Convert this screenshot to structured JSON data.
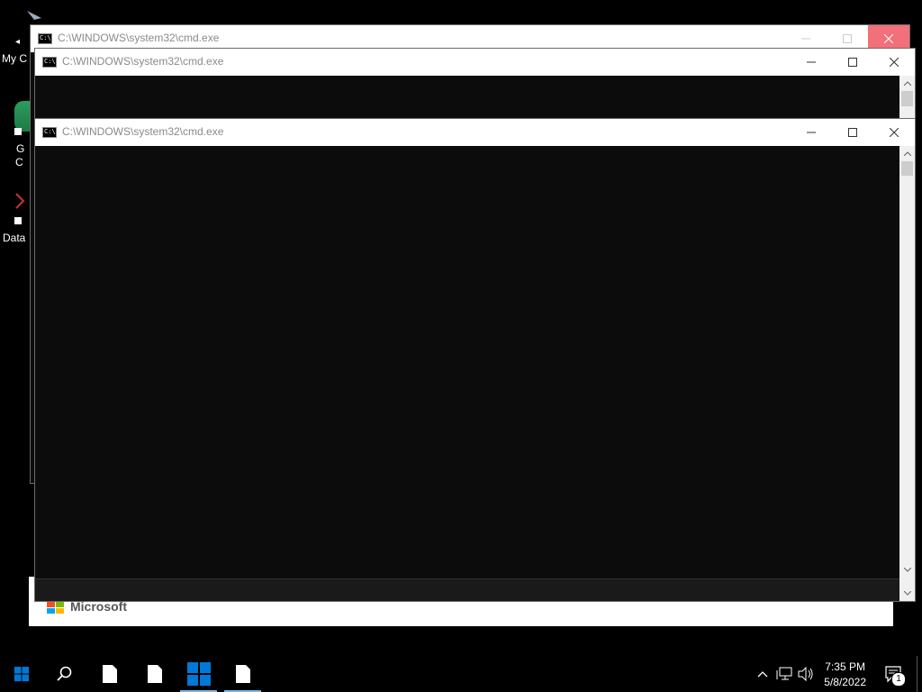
{
  "desktop": {
    "icons": [
      {
        "label": "My C",
        "icon": "computer-icon"
      },
      {
        "label": "G",
        "sub": "C",
        "icon": "chrome-icon"
      },
      {
        "label": "Data",
        "icon": "database-icon"
      }
    ],
    "partial_brand_text": "Microsoft"
  },
  "windows": [
    {
      "title": "C:\\WINDOWS\\system32\\cmd.exe",
      "state": "background"
    },
    {
      "title": "C:\\WINDOWS\\system32\\cmd.exe",
      "state": "middle"
    },
    {
      "title": "C:\\WINDOWS\\system32\\cmd.exe",
      "state": "front"
    }
  ],
  "taskbar": {
    "start_icon": "windows-start-icon",
    "search_icon": "search-icon",
    "apps": [
      "file-icon",
      "file-icon",
      "windows-logo-icon",
      "file-icon"
    ],
    "tray": {
      "icons": [
        "chevron-up-icon",
        "network-icon",
        "volume-icon"
      ],
      "time": "7:35 PM",
      "date": "5/8/2022",
      "notification_count": "1"
    }
  },
  "colors": {
    "accent": "#0078d7",
    "close_hover": "#f1707a",
    "console_bg": "#0c0c0c"
  }
}
